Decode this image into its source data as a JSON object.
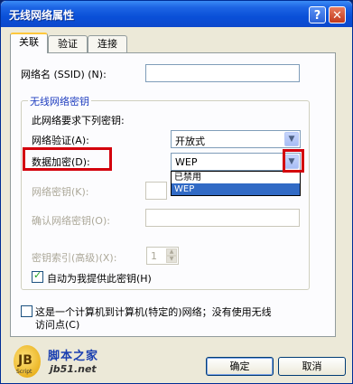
{
  "window": {
    "title": "无线网络属性",
    "help_glyph": "?",
    "close_glyph": "✕"
  },
  "tabs": [
    {
      "label": "关联",
      "active": true
    },
    {
      "label": "验证",
      "active": false
    },
    {
      "label": "连接",
      "active": false
    }
  ],
  "ssid": {
    "label": "网络名 (SSID) (N):",
    "value": ""
  },
  "wireless_key": {
    "group_title": "无线网络密钥",
    "description": "此网络要求下列密钥:",
    "auth": {
      "label": "网络验证(A):",
      "value": "开放式"
    },
    "encryption": {
      "label": "数据加密(D):",
      "value": "WEP",
      "options": [
        "已禁用",
        "WEP"
      ],
      "selected": "WEP"
    },
    "network_key": {
      "label": "网络密钥(K):",
      "value": "",
      "enabled": false
    },
    "confirm_key": {
      "label": "确认网络密钥(O):",
      "value": "",
      "enabled": false
    },
    "key_index": {
      "label": "密钥索引(高级)(X):",
      "value": "1",
      "enabled": false
    },
    "auto_key": {
      "label": "自动为我提供此密钥(H)",
      "checked": true
    }
  },
  "adhoc": {
    "line1": "这是一个计算机到计算机(特定的)网络；没有使用无线",
    "line2": "访问点(C)",
    "checked": false
  },
  "buttons": {
    "ok": "确定",
    "cancel": "取消"
  },
  "watermark": {
    "name": "脚本之家",
    "url": "jb51.net",
    "mark": "JB",
    "sub": "Script"
  },
  "colors": {
    "title_bar": "#0c48cc",
    "highlight_box": "#d3000c",
    "selection": "#316ac5"
  }
}
